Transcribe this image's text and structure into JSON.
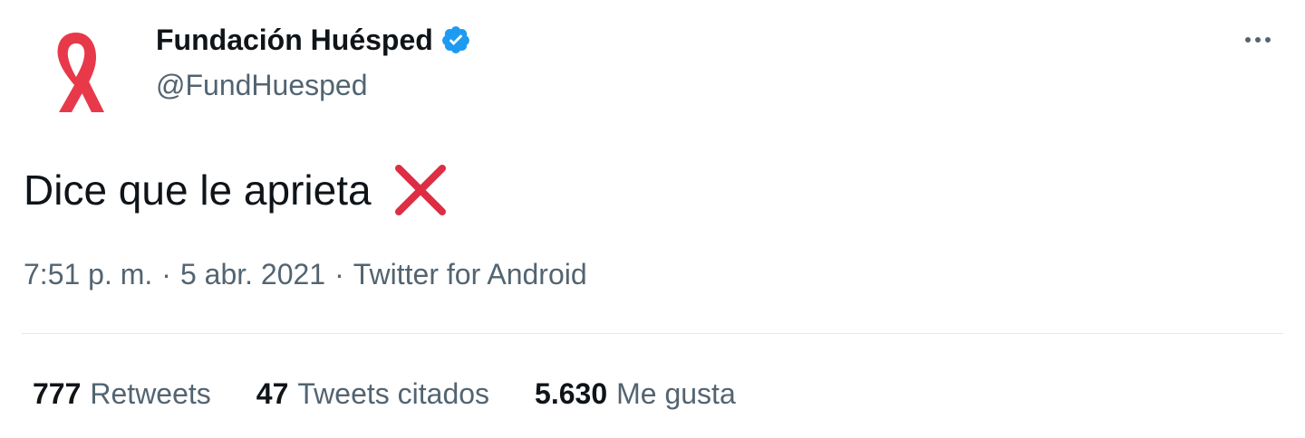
{
  "author": {
    "display_name": "Fundación Huésped",
    "handle": "@FundHuesped",
    "verified": true,
    "avatar_icon": "red-ribbon-icon"
  },
  "menu": {
    "more_icon": "more-horizontal-icon"
  },
  "tweet": {
    "text": "Dice que le aprieta",
    "emoji_icon": "cross-mark-icon"
  },
  "meta": {
    "time": "7:51 p. m.",
    "separator": "·",
    "date": "5 abr. 2021",
    "source": "Twitter for Android"
  },
  "stats": [
    {
      "count": "777",
      "label": "Retweets"
    },
    {
      "count": "47",
      "label": "Tweets citados"
    },
    {
      "count": "5.630",
      "label": "Me gusta"
    }
  ],
  "colors": {
    "text_primary": "#0f1419",
    "text_secondary": "#536471",
    "verified_blue": "#1d9bf0",
    "brand_red": "#e8394b",
    "cross_red": "#dd2e44",
    "divider": "#e3e8ec"
  }
}
